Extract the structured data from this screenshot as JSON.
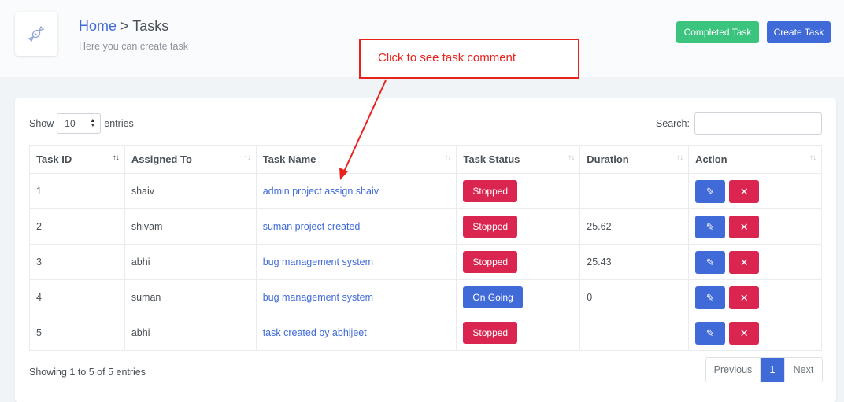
{
  "header": {
    "breadcrumb_home": "Home",
    "breadcrumb_sep": ">",
    "breadcrumb_current": "Tasks",
    "subtitle": "Here you can create task",
    "logo_icon": "candy-icon",
    "completed_task_label": "Completed Task",
    "create_task_label": "Create Task"
  },
  "annotation": {
    "text": "Click to see task comment",
    "color": "#e8231e"
  },
  "controls": {
    "show_label": "Show",
    "entries_value": "10",
    "entries_label": "entries",
    "search_label": "Search:"
  },
  "table": {
    "columns": [
      "Task ID",
      "Assigned To",
      "Task Name",
      "Task Status",
      "Duration",
      "Action"
    ],
    "rows": [
      {
        "id": "1",
        "assigned": "shaiv",
        "name": "admin project assign shaiv",
        "status": "Stopped",
        "duration": ""
      },
      {
        "id": "2",
        "assigned": "shivam",
        "name": "suman project created",
        "status": "Stopped",
        "duration": "25.62"
      },
      {
        "id": "3",
        "assigned": "abhi",
        "name": "bug management system",
        "status": "Stopped",
        "duration": "25.43"
      },
      {
        "id": "4",
        "assigned": "suman",
        "name": "bug management system",
        "status": "On Going",
        "duration": "0"
      },
      {
        "id": "5",
        "assigned": "abhi",
        "name": "task created by abhijeet",
        "status": "Stopped",
        "duration": ""
      }
    ]
  },
  "footer": {
    "info": "Showing 1 to 5 of 5 entries",
    "previous": "Previous",
    "page": "1",
    "next": "Next"
  },
  "colors": {
    "primary": "#3f6ad8",
    "success": "#3ac47d",
    "danger": "#d92550"
  }
}
